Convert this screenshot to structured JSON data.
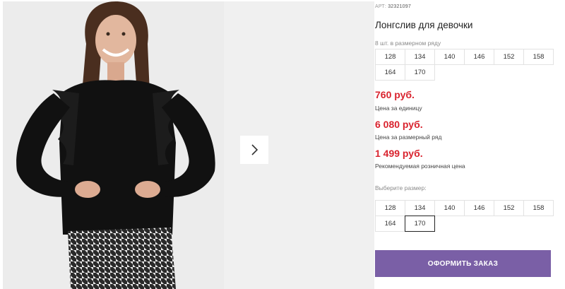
{
  "product": {
    "art_prefix": "АРТ:",
    "art_number": "32321097",
    "title": "Лонгслив для девочки",
    "row_caption": "8 шт. в размерном ряду",
    "row_sizes": [
      "128",
      "134",
      "140",
      "146",
      "152",
      "158",
      "164",
      "170"
    ],
    "prices": [
      {
        "value": "760 руб.",
        "label": "Цена за единицу"
      },
      {
        "value": "6 080 руб.",
        "label": "Цена за размерный ряд"
      },
      {
        "value": "1 499 руб.",
        "label": "Рекомендуемая розничная цена"
      }
    ],
    "choose_label": "Выберите размер:",
    "selectable_sizes": [
      "128",
      "134",
      "140",
      "146",
      "152",
      "158",
      "164",
      "170"
    ],
    "selected_size": "170",
    "order_button": "ОФОРМИТЬ ЗАКАЗ"
  },
  "gallery": {
    "image_subject": "girl-in-black-longsleeve-photo",
    "next_icon": "chevron-right-icon"
  },
  "colors": {
    "price": "#d9232e",
    "order_button": "#7a5fa6",
    "photo_background": "#ececec"
  }
}
